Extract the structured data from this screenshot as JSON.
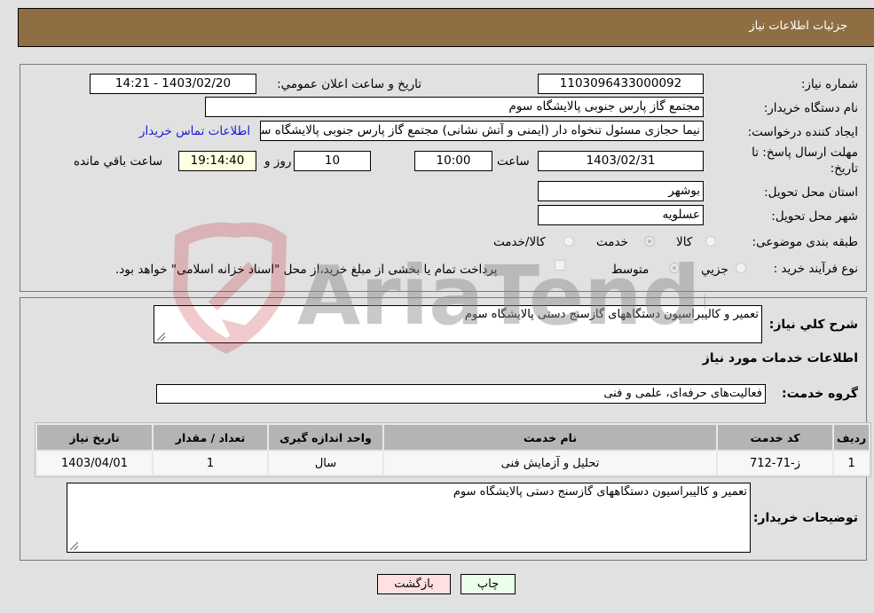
{
  "header": {
    "title": "جزئیات اطلاعات نیاز"
  },
  "form": {
    "need_number": {
      "label": "شماره نیاز:",
      "value": "1103096433000092"
    },
    "announce_datetime": {
      "label": "تاریخ و ساعت اعلان عمومي:",
      "value": "1403/02/20 - 14:21"
    },
    "buyer_org": {
      "label": "نام دستگاه خریدار:",
      "value": "مجتمع گاز پارس جنوبی  پالایشگاه سوم"
    },
    "requester": {
      "label": "ایجاد کننده درخواست:",
      "value": "نیما حجازی مسئول تنخواه دار  (ایمنی و آتش نشانی) مجتمع گاز پارس جنوبی  پالایشگاه سوم"
    },
    "buyer_contact_link": "اطلاعات تماس خریدار",
    "deadline": {
      "label_line1": "مهلت ارسال پاسخ: تا",
      "label_line2": "تاریخ:",
      "date": "1403/02/31",
      "time_label": "ساعت",
      "time": "10:00",
      "days": "10",
      "days_label": "روز و",
      "remaining": "19:14:40",
      "remaining_label": "ساعت باقي مانده"
    },
    "province": {
      "label": "استان محل تحویل:",
      "value": "بوشهر"
    },
    "city": {
      "label": "شهر محل تحویل:",
      "value": "عسلویه"
    },
    "category": {
      "label": "طبقه بندی موضوعی:",
      "options": [
        {
          "label": "کالا",
          "checked": false
        },
        {
          "label": "خدمت",
          "checked": true
        },
        {
          "label": "کالا/خدمت",
          "checked": false
        }
      ]
    },
    "purchase_type": {
      "label": "نوع فرآیند خرید :",
      "options": [
        {
          "label": "جزيي",
          "checked": false
        },
        {
          "label": "متوسط",
          "checked": true
        }
      ],
      "treasury_note": "پرداخت تمام یا بخشی از مبلغ خرید،از محل \"اسناد خزانه اسلامی\" خواهد بود."
    }
  },
  "details": {
    "summary_label": "شرح کلي نیاز:",
    "summary_value": "تعمیر و کالیبراسیون دستگاههای گازسنج دستی پالایشگاه سوم",
    "services_heading": "اطلاعات خدمات مورد نیاز",
    "service_group_label": "گروه خدمت:",
    "service_group_value": "فعالیت‌های حرفه‌ای، علمی و فنی",
    "table": {
      "headers": [
        "ردیف",
        "کد خدمت",
        "نام خدمت",
        "واحد اندازه گیری",
        "تعداد / مقدار",
        "تاریخ نیاز"
      ],
      "rows": [
        [
          "1",
          "ز-71-712",
          "تحلیل و آزمایش فنی",
          "سال",
          "1",
          "1403/04/01"
        ]
      ]
    },
    "buyer_notes_label": "توضیحات خریدار:",
    "buyer_notes_value": "تعمیر و کالیبراسیون دستگاههای گازسنج دستی پالایشگاه سوم"
  },
  "buttons": {
    "print": "چاپ",
    "back": "بازگشت"
  },
  "colors": {
    "header_bg": "#8f6e43",
    "print_bg": "#eaffea",
    "back_bg": "#ffe0e0",
    "link": "#1a1ad6"
  },
  "watermark": {
    "text": "AriaTender.neT"
  }
}
